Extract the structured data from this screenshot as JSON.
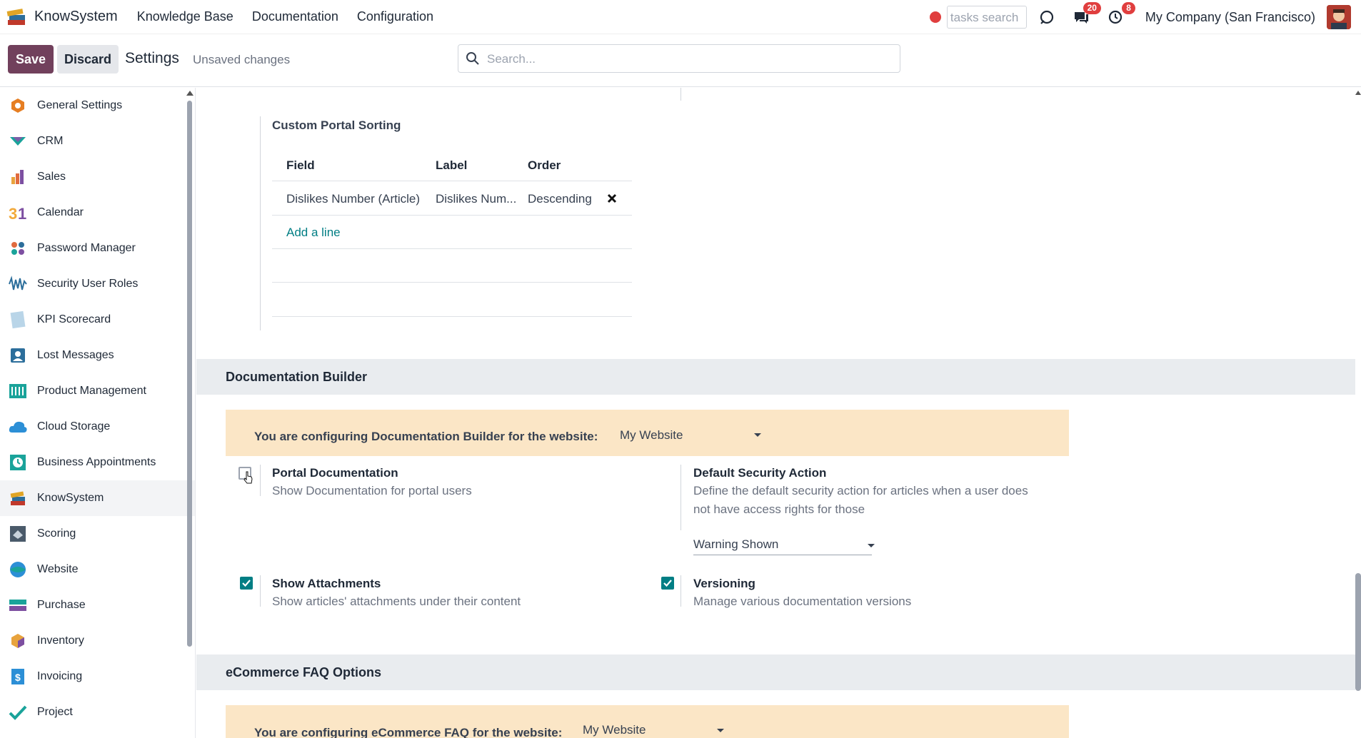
{
  "navbar": {
    "brand": "KnowSystem",
    "menu": [
      "Knowledge Base",
      "Documentation",
      "Configuration"
    ],
    "tasks_search_placeholder": "tasks search",
    "messages_count": "20",
    "activities_count": "8",
    "company": "My Company (San Francisco)"
  },
  "control": {
    "save": "Save",
    "discard": "Discard",
    "title": "Settings",
    "status": "Unsaved changes",
    "search_placeholder": "Search..."
  },
  "sidebar": {
    "items": [
      {
        "label": "General Settings",
        "icon": "general-settings-icon"
      },
      {
        "label": "CRM",
        "icon": "crm-icon"
      },
      {
        "label": "Sales",
        "icon": "sales-icon"
      },
      {
        "label": "Calendar",
        "icon": "calendar-icon"
      },
      {
        "label": "Password Manager",
        "icon": "password-manager-icon"
      },
      {
        "label": "Security User Roles",
        "icon": "security-roles-icon"
      },
      {
        "label": "KPI Scorecard",
        "icon": "kpi-icon"
      },
      {
        "label": "Lost Messages",
        "icon": "lost-messages-icon"
      },
      {
        "label": "Product Management",
        "icon": "product-management-icon"
      },
      {
        "label": "Cloud Storage",
        "icon": "cloud-storage-icon"
      },
      {
        "label": "Business Appointments",
        "icon": "appointments-icon"
      },
      {
        "label": "KnowSystem",
        "icon": "knowsystem-icon",
        "active": true
      },
      {
        "label": "Scoring",
        "icon": "scoring-icon"
      },
      {
        "label": "Website",
        "icon": "website-icon"
      },
      {
        "label": "Purchase",
        "icon": "purchase-icon"
      },
      {
        "label": "Inventory",
        "icon": "inventory-icon"
      },
      {
        "label": "Invoicing",
        "icon": "invoicing-icon"
      },
      {
        "label": "Project",
        "icon": "project-icon"
      }
    ]
  },
  "portal_sorting": {
    "title": "Custom Portal Sorting",
    "headers": [
      "Field",
      "Label",
      "Order"
    ],
    "rows": [
      {
        "field": "Dislikes Number (Article)",
        "label": "Dislikes Num...",
        "order": "Descending"
      }
    ],
    "add_line": "Add a line"
  },
  "doc_builder": {
    "title": "Documentation Builder",
    "alert_text": "You are configuring Documentation Builder for the website:",
    "website": "My Website",
    "portal_documentation": {
      "title": "Portal Documentation",
      "desc": "Show Documentation for portal users",
      "checked": false
    },
    "default_security": {
      "title": "Default Security Action",
      "desc": "Define the default security action for articles when a user does not have access rights for those",
      "value": "Warning Shown"
    },
    "show_attachments": {
      "title": "Show Attachments",
      "desc": "Show articles' attachments under their content",
      "checked": true
    },
    "versioning": {
      "title": "Versioning",
      "desc": "Manage various documentation versions",
      "checked": true
    }
  },
  "ecommerce_faq": {
    "title": "eCommerce FAQ Options",
    "alert_text": "You are configuring eCommerce FAQ for the website:",
    "website": "My Website"
  },
  "colors": {
    "primary": "#71405c",
    "accent": "#017e84",
    "alert_bg": "#fbe6c6",
    "section_bg": "#e9ecef"
  }
}
